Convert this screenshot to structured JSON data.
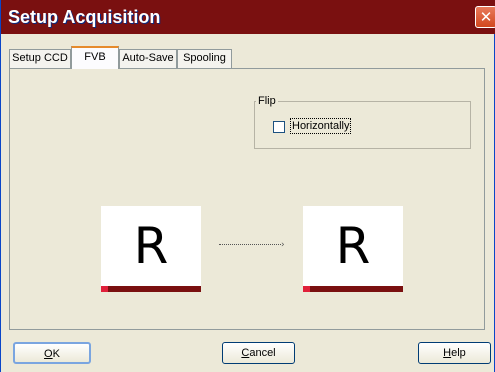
{
  "window": {
    "title": "Setup Acquisition",
    "close_glyph": "✕"
  },
  "tabs": [
    {
      "label": "Setup CCD",
      "active": false
    },
    {
      "label": "FVB",
      "active": true
    },
    {
      "label": "Auto-Save",
      "active": false
    },
    {
      "label": "Spooling",
      "active": false
    }
  ],
  "flip": {
    "group_label": "Flip",
    "horizontally": {
      "label": "Horizontally",
      "checked": false
    }
  },
  "preview": {
    "source_letter": "R",
    "result_letter": "R",
    "arrow_glyph": "›",
    "bar_color": "#7a1010",
    "bar_lead_color": "#e0203a"
  },
  "buttons": {
    "ok": {
      "first": "O",
      "rest": "K"
    },
    "cancel": {
      "first": "C",
      "rest": "ancel"
    },
    "help": {
      "first": "H",
      "rest": "elp"
    }
  }
}
